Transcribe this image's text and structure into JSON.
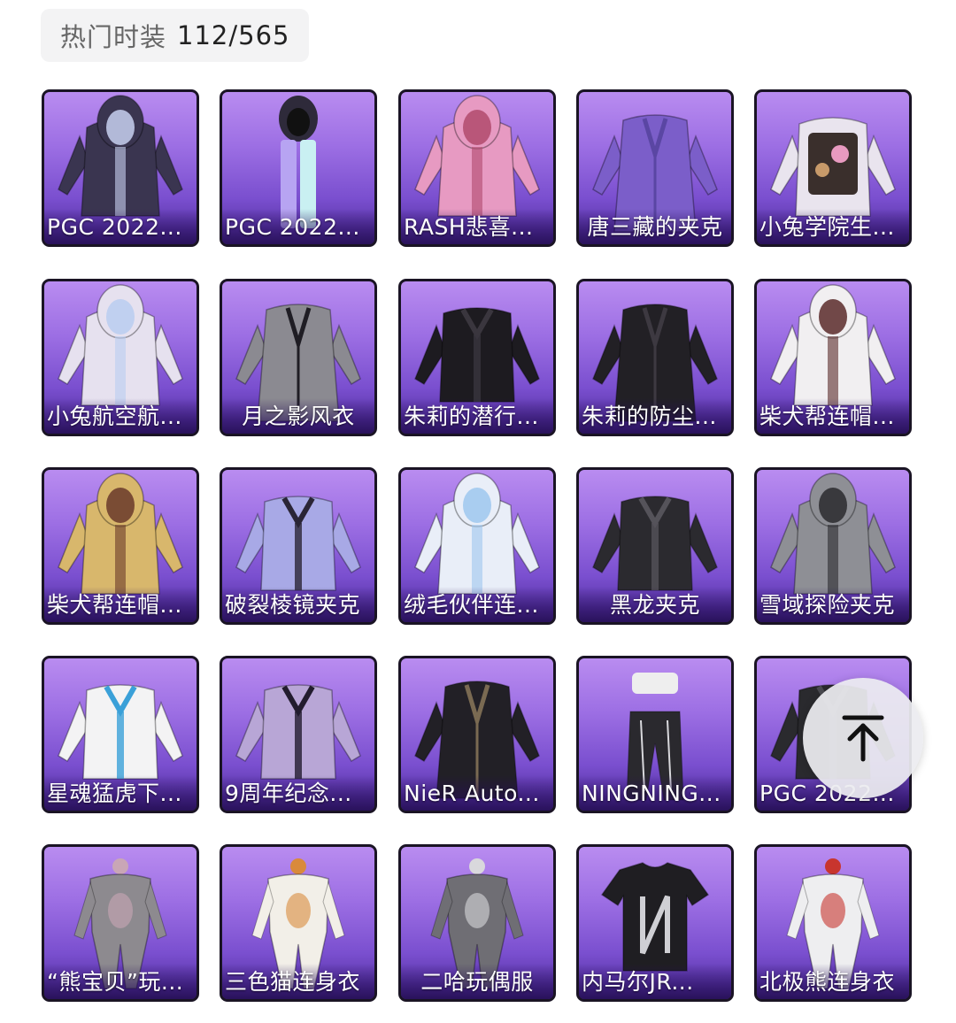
{
  "header": {
    "label": "热门时装",
    "count": "112/565"
  },
  "items": [
    {
      "name": "PGC 2022...",
      "garment": "hooded-jacket",
      "color": "#3a3550",
      "accent": "#c8d0f0"
    },
    {
      "name": "PGC 2022...",
      "garment": "hood-scarf",
      "color": "#2e2a3a",
      "accent": "#b7a4f2"
    },
    {
      "name": "RASH悲喜...",
      "garment": "hooded-jacket",
      "color": "#e79ac2",
      "accent": "#b04a6c"
    },
    {
      "name": "唐三藏的夹克",
      "garment": "robe",
      "color": "#7b5ec9",
      "accent": "#5a46a3"
    },
    {
      "name": "小兔学院生...",
      "garment": "vest-jacket",
      "color": "#e9e4ee",
      "accent": "#3a2f2c"
    },
    {
      "name": "小兔航空航...",
      "garment": "hooded-jacket",
      "color": "#e6e1ef",
      "accent": "#b9cdf0"
    },
    {
      "name": "月之影风衣",
      "garment": "coat",
      "color": "#8b8a91",
      "accent": "#1f1d24"
    },
    {
      "name": "朱莉的潜行...",
      "garment": "jacket",
      "color": "#1d1b20",
      "accent": "#3a363e"
    },
    {
      "name": "朱莉的防尘...",
      "garment": "coat",
      "color": "#222025",
      "accent": "#3d3941"
    },
    {
      "name": "柴犬帮连帽...",
      "garment": "hoodie",
      "color": "#f1eff1",
      "accent": "#5a2a2a"
    },
    {
      "name": "柴犬帮连帽...",
      "garment": "hoodie",
      "color": "#d8b76c",
      "accent": "#6a3a2a"
    },
    {
      "name": "破裂棱镜夹克",
      "garment": "jacket",
      "color": "#a8a9e6",
      "accent": "#2a2536"
    },
    {
      "name": "绒毛伙伴连...",
      "garment": "hoodie",
      "color": "#e9eef8",
      "accent": "#9ec7ef"
    },
    {
      "name": "黑龙夹克",
      "garment": "jacket",
      "color": "#2b2a2f",
      "accent": "#55535a"
    },
    {
      "name": "雪域探险夹克",
      "garment": "hoodie",
      "color": "#8e8f95",
      "accent": "#2a2a2e"
    },
    {
      "name": "星魂猛虎下...",
      "garment": "jacket",
      "color": "#f3f3f4",
      "accent": "#3aa0d8"
    },
    {
      "name": "9周年纪念...",
      "garment": "jacket",
      "color": "#b8a6d6",
      "accent": "#221c2e"
    },
    {
      "name": "NieR Auto...",
      "garment": "coat",
      "color": "#222026",
      "accent": "#7a6a52"
    },
    {
      "name": "NINGNING...",
      "garment": "pants-set",
      "color": "#2a292e",
      "accent": "#d8d8dc"
    },
    {
      "name": "PGC 2022...",
      "garment": "jacket",
      "color": "#2a2a2e",
      "accent": "#4a4a50"
    },
    {
      "name": "“熊宝贝”玩...",
      "garment": "jumpsuit",
      "color": "#8d8a8f",
      "accent": "#c9a6b6"
    },
    {
      "name": "三色猫连身衣",
      "garment": "jumpsuit",
      "color": "#f2efe8",
      "accent": "#d98a3c"
    },
    {
      "name": "二哈玩偶服",
      "garment": "jumpsuit",
      "color": "#6f6e74",
      "accent": "#d9d8dc"
    },
    {
      "name": "内马尔JR...",
      "garment": "tshirt",
      "color": "#1f1e22",
      "accent": "#cfcfd4"
    },
    {
      "name": "北极熊连身衣",
      "garment": "jumpsuit",
      "color": "#eeeef0",
      "accent": "#c8352e"
    }
  ],
  "centered_names": [
    "唐三藏的夹克",
    "黑龙夹克",
    "二哈玩偶服",
    "月之影风衣"
  ],
  "scroll_top_icon": "arrow-up-to-top-icon",
  "colors": {
    "tile_top": "#b98cf0",
    "tile_bottom": "#4c2a98",
    "tile_border": "#1a1424"
  }
}
